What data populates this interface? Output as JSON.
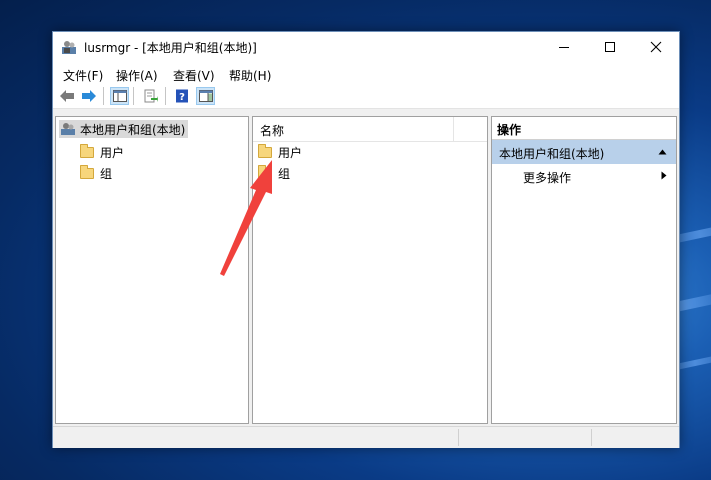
{
  "window": {
    "title": "lusrmgr - [本地用户和组(本地)]",
    "minimize_glyph": "—",
    "maximize_glyph": "☐",
    "close_glyph": "✕"
  },
  "menu": [
    {
      "label": "文件(F)"
    },
    {
      "label": "操作(A)"
    },
    {
      "label": "查看(V)"
    },
    {
      "label": "帮助(H)"
    }
  ],
  "toolbar": {
    "icons": [
      "back-arrow-icon",
      "forward-arrow-icon",
      "show-hide-tree-icon",
      "export-list-icon",
      "help-icon",
      "show-hide-action-pane-icon"
    ]
  },
  "tree": {
    "root_label": "本地用户和组(本地)",
    "items": [
      {
        "label": "用户"
      },
      {
        "label": "组"
      }
    ]
  },
  "list": {
    "column_name": "名称",
    "items": [
      {
        "label": "用户"
      },
      {
        "label": "组"
      }
    ]
  },
  "actions": {
    "title": "操作",
    "section_label": "本地用户和组(本地)",
    "more_label": "更多操作"
  },
  "colors": {
    "annotation_arrow": "#f0413c",
    "selected_section": "#b8d0ea"
  }
}
